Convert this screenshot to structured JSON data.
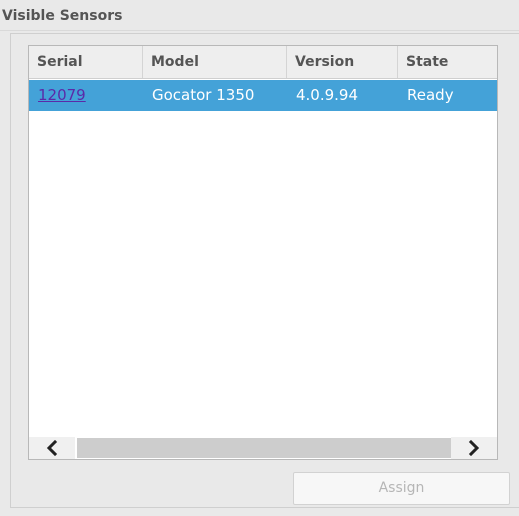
{
  "panel": {
    "title": "Visible Sensors"
  },
  "table": {
    "columns": [
      "Serial",
      "Model",
      "Version",
      "State"
    ],
    "rows": [
      {
        "serial": "12079",
        "model": "Gocator 1350",
        "version": "4.0.9.94",
        "state": "Ready",
        "selected": true
      }
    ]
  },
  "scrollbar": {
    "left_icon": "chevron-left-icon",
    "right_icon": "chevron-right-icon"
  },
  "actions": {
    "assign_label": "Assign",
    "assign_enabled": false
  },
  "colors": {
    "selection": "#44a2d8",
    "link": "#5b2aa8",
    "panel_bg": "#e9e9e9",
    "disabled_text": "#b6b6b6"
  }
}
